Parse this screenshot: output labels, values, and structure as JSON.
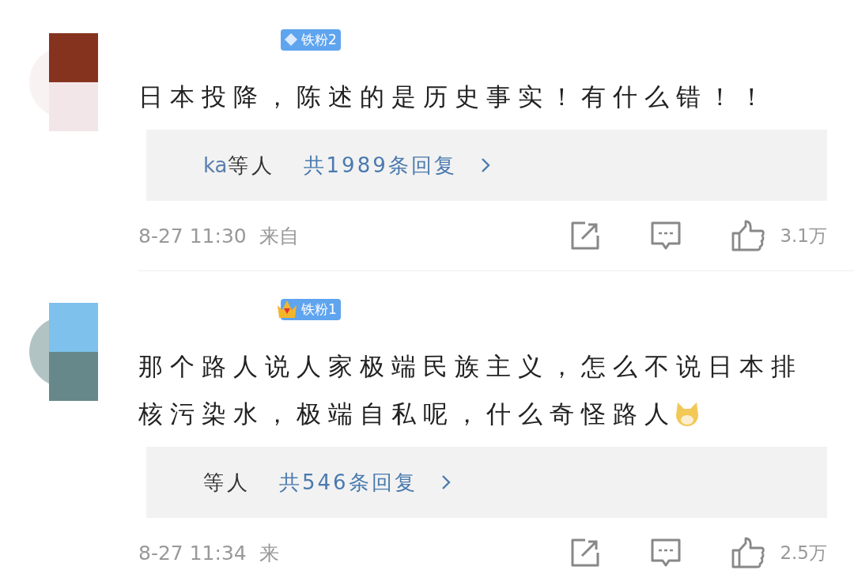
{
  "comments": [
    {
      "avatar": {
        "kind": "picture"
      },
      "badge": {
        "kind": "diamond",
        "label": "铁粉2"
      },
      "text_lines": [
        "日本投降，陈述的是历史事实！有什么错！！"
      ],
      "emoji": false,
      "replies": {
        "user": "ka",
        "others": "等人",
        "total": "共1989条回复"
      },
      "time": "8-27 11:30",
      "source": "来自",
      "likes": "3.1万"
    },
    {
      "avatar": {
        "kind": "picture"
      },
      "badge": {
        "kind": "crown",
        "label": "铁粉1"
      },
      "text_lines": [
        "那个路人说人家极端民族主义，怎么不说日本排",
        "核污染水，极端自私呢，什么奇怪路人"
      ],
      "emoji": true,
      "replies": {
        "others": "等人",
        "total": "共546条回复"
      },
      "time": "8-27 11:34",
      "source": "来",
      "likes": "2.5万"
    }
  ]
}
